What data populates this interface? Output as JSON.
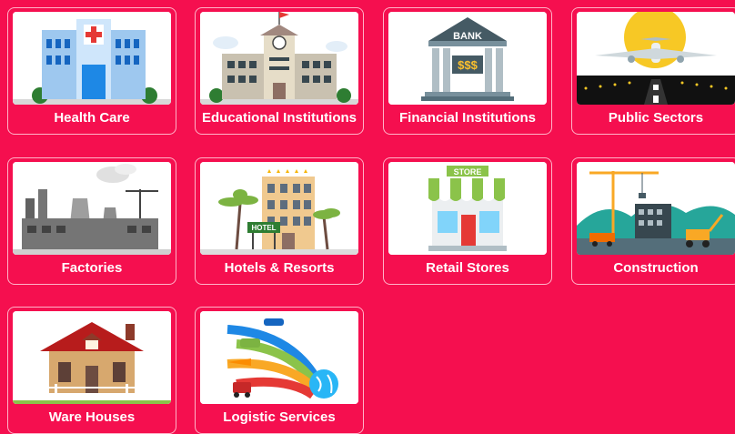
{
  "cards": [
    {
      "label": "Health Care",
      "icon": "hospital-icon"
    },
    {
      "label": "Educational Institutions",
      "icon": "school-icon"
    },
    {
      "label": "Financial Institutions",
      "icon": "bank-icon"
    },
    {
      "label": "Public Sectors",
      "icon": "airplane-runway-icon"
    },
    {
      "label": "Factories",
      "icon": "factory-icon"
    },
    {
      "label": "Hotels & Resorts",
      "icon": "hotel-icon"
    },
    {
      "label": "Retail Stores",
      "icon": "store-icon"
    },
    {
      "label": "Construction",
      "icon": "construction-site-icon"
    },
    {
      "label": "Ware Houses",
      "icon": "warehouse-icon"
    },
    {
      "label": "Logistic Services",
      "icon": "logistics-icon"
    }
  ],
  "illustrations": {
    "bank_sign": "BANK",
    "bank_symbol": "$$$",
    "hotel_sign": "HOTEL",
    "store_sign": "STORE"
  },
  "colors": {
    "background": "#f50f4f",
    "card_border": "#ffb3c8",
    "label": "#ffffff"
  }
}
